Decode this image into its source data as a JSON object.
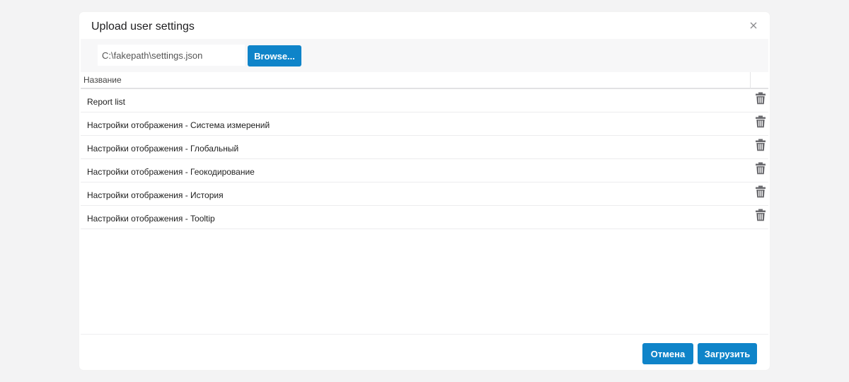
{
  "dialog": {
    "title": "Upload user settings",
    "close_icon": "close-icon"
  },
  "file": {
    "value": "C:\\fakepath\\settings.json",
    "browse_label": "Browse..."
  },
  "table": {
    "column_name": "Название",
    "rows": [
      {
        "label": "Report list",
        "action_icon": "trash-icon"
      },
      {
        "label": "Настройки отображения - Система измерений",
        "action_icon": "trash-icon"
      },
      {
        "label": "Настройки отображения - Глобальный",
        "action_icon": "trash-icon"
      },
      {
        "label": "Настройки отображения - Геокодирование",
        "action_icon": "trash-icon"
      },
      {
        "label": "Настройки отображения - История",
        "action_icon": "trash-icon"
      },
      {
        "label": "Настройки отображения - Tooltip",
        "action_icon": "trash-icon"
      }
    ]
  },
  "footer": {
    "cancel_label": "Отмена",
    "upload_label": "Загрузить"
  },
  "colors": {
    "accent": "#0f84c9",
    "icon": "#6b6b6f",
    "background": "#f3f3f4"
  }
}
